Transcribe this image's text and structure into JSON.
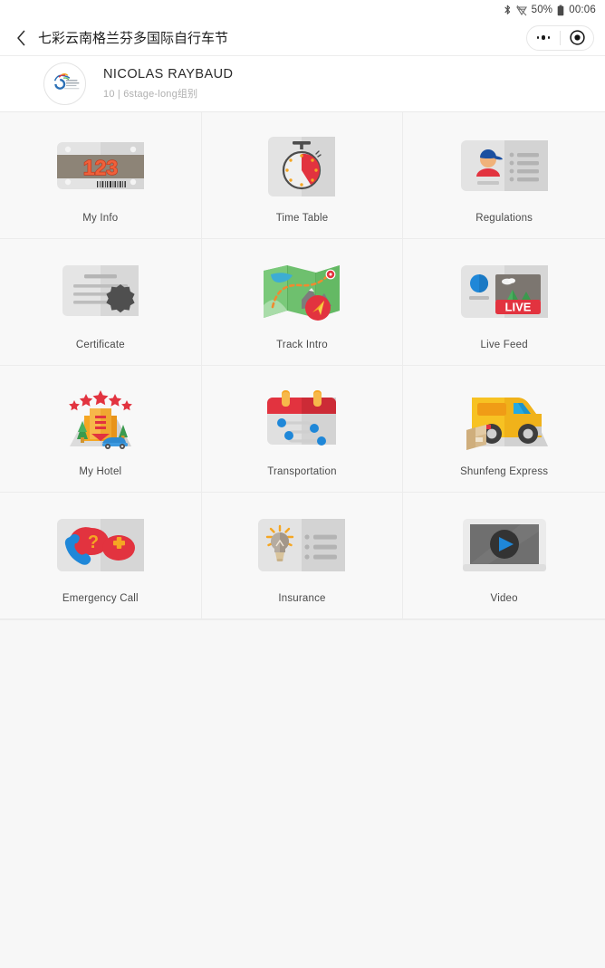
{
  "status_bar": {
    "bluetooth_icon": "bluetooth-icon",
    "wifi_icon": "wifi-off-icon",
    "battery_percent": "50%",
    "battery_icon": "battery-icon",
    "time": "00:06"
  },
  "header": {
    "back_icon": "chevron-left-icon",
    "title": "七彩云南格兰芬多国际自行车节",
    "more_icon": "more-dots-icon",
    "target_icon": "target-circle-icon"
  },
  "profile": {
    "avatar_icon": "event-logo-avatar",
    "name": "NICOLAS RAYBAUD",
    "subtitle": "10 | 6stage-long组别"
  },
  "grid": {
    "items": [
      {
        "label": "My Info",
        "icon": "race-bib-icon",
        "bib_number": "123"
      },
      {
        "label": "Time Table",
        "icon": "stopwatch-icon"
      },
      {
        "label": "Regulations",
        "icon": "id-card-person-icon"
      },
      {
        "label": "Certificate",
        "icon": "certificate-seal-icon"
      },
      {
        "label": "Track Intro",
        "icon": "folded-map-navigation-icon"
      },
      {
        "label": "Live Feed",
        "icon": "live-broadcast-icon",
        "badge": "LIVE"
      },
      {
        "label": "My Hotel",
        "icon": "hotel-stars-icon"
      },
      {
        "label": "Transportation",
        "icon": "calendar-schedule-icon"
      },
      {
        "label": "Shunfeng Express",
        "icon": "delivery-van-icon"
      },
      {
        "label": "Emergency Call",
        "icon": "emergency-phone-icon"
      },
      {
        "label": "Insurance",
        "icon": "lightbulb-list-icon"
      },
      {
        "label": "Video",
        "icon": "video-play-icon"
      }
    ]
  },
  "colors": {
    "page_bg": "#f7f7f7",
    "surface": "#ffffff",
    "divider": "#ececec",
    "text_primary": "#2b2b2b",
    "text_secondary": "#b0b0b0",
    "accent_red": "#e2333f",
    "accent_blue": "#1f87d8",
    "accent_orange": "#f5a623",
    "accent_green": "#5cb85c"
  }
}
